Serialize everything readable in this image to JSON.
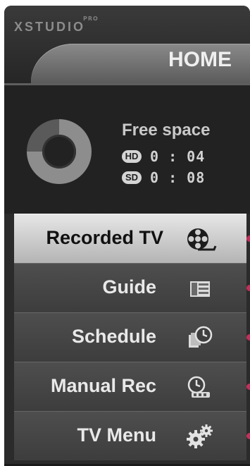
{
  "header": {
    "brand": "XSTUDIO",
    "brand_badge": "PRO",
    "title": "HOME"
  },
  "storage": {
    "label": "Free space",
    "hd": {
      "badge": "HD",
      "value": "0 : 04"
    },
    "sd": {
      "badge": "SD",
      "value": "0 : 08"
    },
    "used_fraction": 0.75
  },
  "menu": {
    "items": [
      {
        "label": "Recorded TV",
        "icon": "film-reel-icon",
        "selected": true
      },
      {
        "label": "Guide",
        "icon": "guide-list-icon",
        "selected": false
      },
      {
        "label": "Schedule",
        "icon": "schedule-clock-icon",
        "selected": false
      },
      {
        "label": "Manual Rec",
        "icon": "manual-rec-clock-icon",
        "selected": false
      },
      {
        "label": "TV Menu",
        "icon": "gears-icon",
        "selected": false
      }
    ]
  },
  "colors": {
    "pointer": "#c0305a",
    "selected_bg": "#d8d8d8",
    "panel_bg": "#222222"
  }
}
